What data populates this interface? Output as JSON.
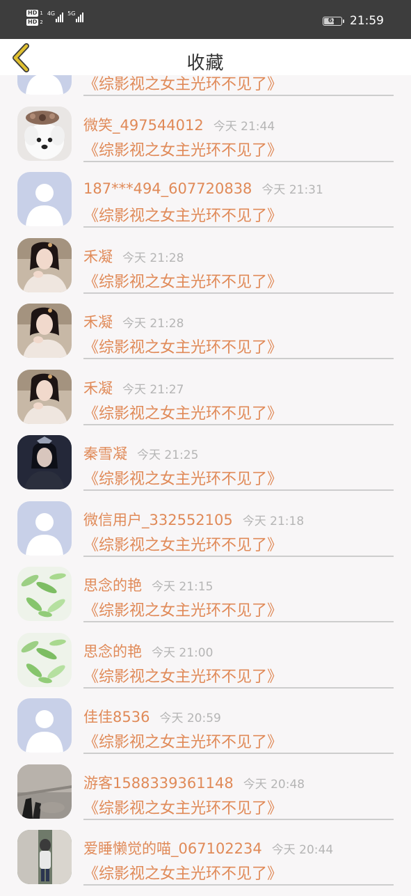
{
  "status_bar": {
    "hd1": "HD",
    "hd1_sub": "1",
    "hd2": "HD",
    "hd2_sub": "2",
    "net1": "4G",
    "net2": "5G",
    "battery_level": "63",
    "time": "21:59"
  },
  "header": {
    "title": "收藏",
    "back_icon": "chevron-left-icon",
    "accent_color": "#e0c030"
  },
  "colors": {
    "name": "#e08a58",
    "time": "#b5b5b5",
    "divider": "#cdcdcd",
    "background": "#f8f6f7"
  },
  "items": [
    {
      "name": "",
      "time": "",
      "book": "《综影视之女主光环不见了》",
      "avatar": "default"
    },
    {
      "name": "微笑_497544012",
      "time": "今天 21:44",
      "book": "《综影视之女主光环不见了》",
      "avatar": "puppy"
    },
    {
      "name": "187***494_607720838",
      "time": "今天 21:31",
      "book": "《综影视之女主光环不见了》",
      "avatar": "default"
    },
    {
      "name": "禾凝",
      "time": "今天 21:28",
      "book": "《综影视之女主光环不见了》",
      "avatar": "girl"
    },
    {
      "name": "禾凝",
      "time": "今天 21:28",
      "book": "《综影视之女主光环不见了》",
      "avatar": "girl"
    },
    {
      "name": "禾凝",
      "time": "今天 21:27",
      "book": "《综影视之女主光环不见了》",
      "avatar": "girl"
    },
    {
      "name": "秦雪凝",
      "time": "今天 21:25",
      "book": "《综影视之女主光环不见了》",
      "avatar": "dark"
    },
    {
      "name": "微信用户_332552105",
      "time": "今天 21:18",
      "book": "《综影视之女主光环不见了》",
      "avatar": "default"
    },
    {
      "name": "思念的艳",
      "time": "今天 21:15",
      "book": "《综影视之女主光环不见了》",
      "avatar": "leaves"
    },
    {
      "name": "思念的艳",
      "time": "今天 21:00",
      "book": "《综影视之女主光环不见了》",
      "avatar": "leaves"
    },
    {
      "name": "佳佳8536",
      "time": "今天 20:59",
      "book": "《综影视之女主光环不见了》",
      "avatar": "default"
    },
    {
      "name": "游客1588339361148",
      "time": "今天 20:48",
      "book": "《综影视之女主光环不见了》",
      "avatar": "floor"
    },
    {
      "name": "爱睡懒觉的喵_067102234",
      "time": "今天 20:44",
      "book": "《综影视之女主光环不见了》",
      "avatar": "room"
    }
  ]
}
